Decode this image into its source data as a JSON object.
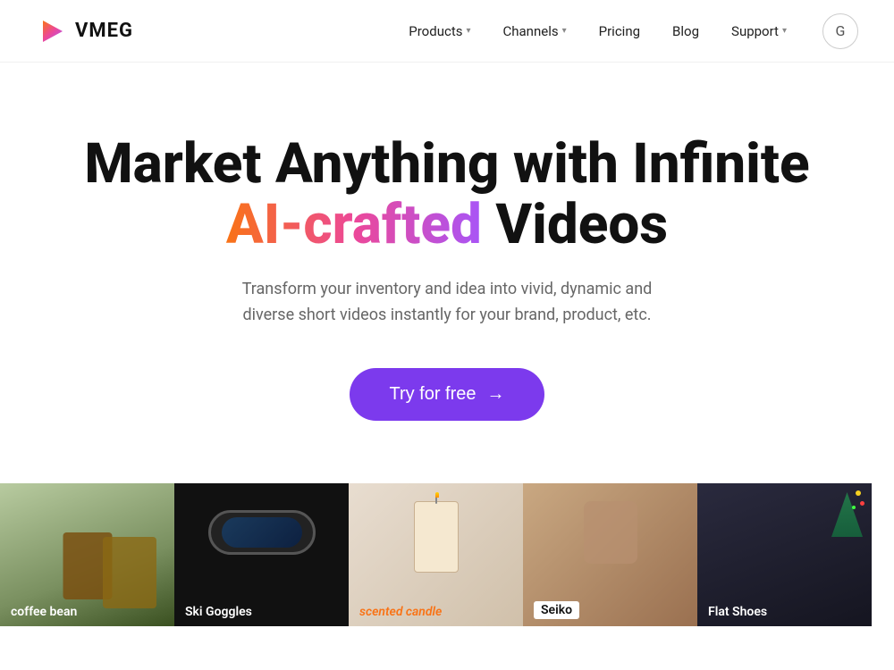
{
  "logo": {
    "text": "VMEG"
  },
  "nav": {
    "items": [
      {
        "label": "Products",
        "has_dropdown": true
      },
      {
        "label": "Channels",
        "has_dropdown": true
      },
      {
        "label": "Pricing",
        "has_dropdown": false
      },
      {
        "label": "Blog",
        "has_dropdown": false
      },
      {
        "label": "Support",
        "has_dropdown": true
      }
    ],
    "cta_icon": "G"
  },
  "hero": {
    "title_line1": "Market Anything with Infinite",
    "title_ai": "AI-crafted",
    "title_line2": " Videos",
    "subtitle": "Transform your inventory and idea into vivid, dynamic and diverse short videos instantly for your brand, product, etc.",
    "cta_button": "Try for free",
    "cta_arrow": "→"
  },
  "cards": [
    {
      "label": "coffee bean",
      "label_style": "white",
      "bg": "coffee"
    },
    {
      "label": "Ski Goggles",
      "label_style": "white",
      "bg": "goggles"
    },
    {
      "label": "scented candle",
      "label_style": "orange",
      "bg": "candle"
    },
    {
      "label": "Seiko",
      "label_style": "box",
      "bg": "seiko"
    },
    {
      "label": "Flat Shoes",
      "label_style": "white",
      "bg": "shoes"
    }
  ]
}
